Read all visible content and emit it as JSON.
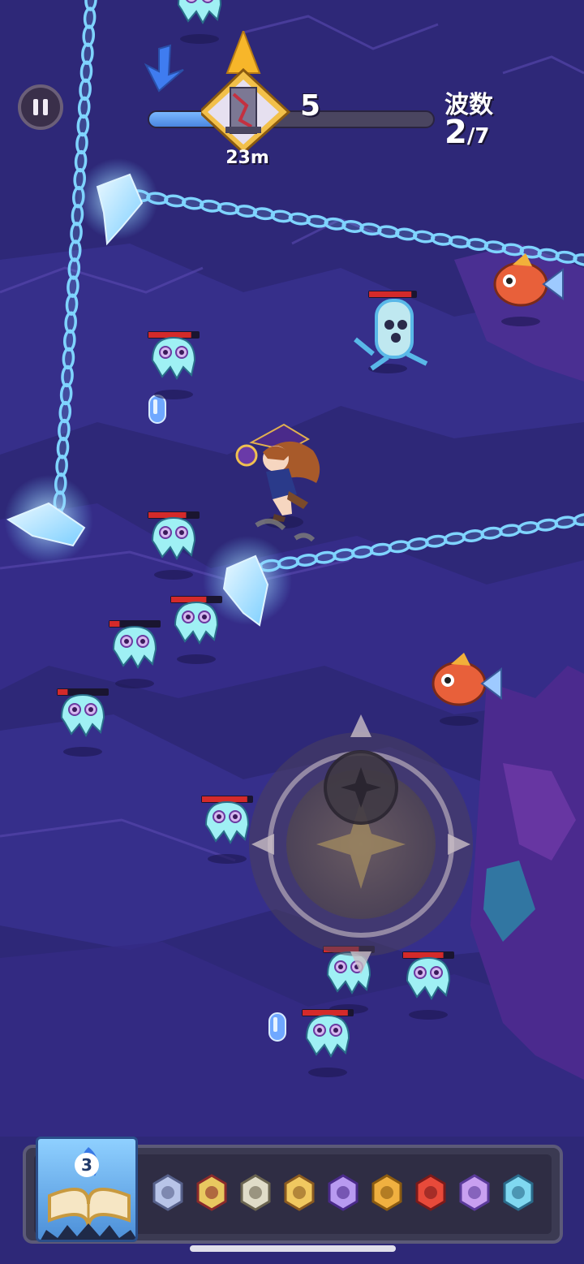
{
  "hud": {
    "level": "5",
    "distance": "23m",
    "wave_label": "波数",
    "wave_current": "2",
    "wave_total": "/7",
    "progress_fraction": 0.27
  },
  "skill_bar": {
    "book_count": "3",
    "slots": [
      {
        "icon": "shield-orb-icon"
      },
      {
        "icon": "jester-box-icon"
      },
      {
        "icon": "scroll-mask-icon"
      },
      {
        "icon": "treasure-map-icon"
      },
      {
        "icon": "twin-pendant-icon"
      },
      {
        "icon": "golden-horseshoe-icon"
      },
      {
        "icon": "red-feather-icon"
      },
      {
        "icon": "mushroom-orb-icon"
      },
      {
        "icon": "magic-wand-icon"
      }
    ]
  },
  "colors": {
    "background": "#2e2878",
    "chain": "#7fd4ff",
    "enemy_body": "#9ff0f4",
    "health_bar": "#d42a2a",
    "joystick": "#6b5a5c"
  },
  "enemies": [
    {
      "kind": "jelly-ghost",
      "health": 0.85
    },
    {
      "kind": "jelly-ghost",
      "health": 0.75
    },
    {
      "kind": "jelly-ghost",
      "health": 0.7
    },
    {
      "kind": "jelly-ghost",
      "health": 0.2
    },
    {
      "kind": "jelly-ghost",
      "health": 0.2
    },
    {
      "kind": "jelly-ghost",
      "health": 0.9
    },
    {
      "kind": "jelly-ghost",
      "health": 0.7
    },
    {
      "kind": "jelly-ghost",
      "health": 0.8
    },
    {
      "kind": "jelly-ghost",
      "health": 0.9
    },
    {
      "kind": "jelly-ghost",
      "health": 0.2
    },
    {
      "kind": "squid-tower",
      "health": 0.9
    },
    {
      "kind": "pufferfish",
      "health": 1.0
    },
    {
      "kind": "pufferfish",
      "health": 1.0
    }
  ]
}
